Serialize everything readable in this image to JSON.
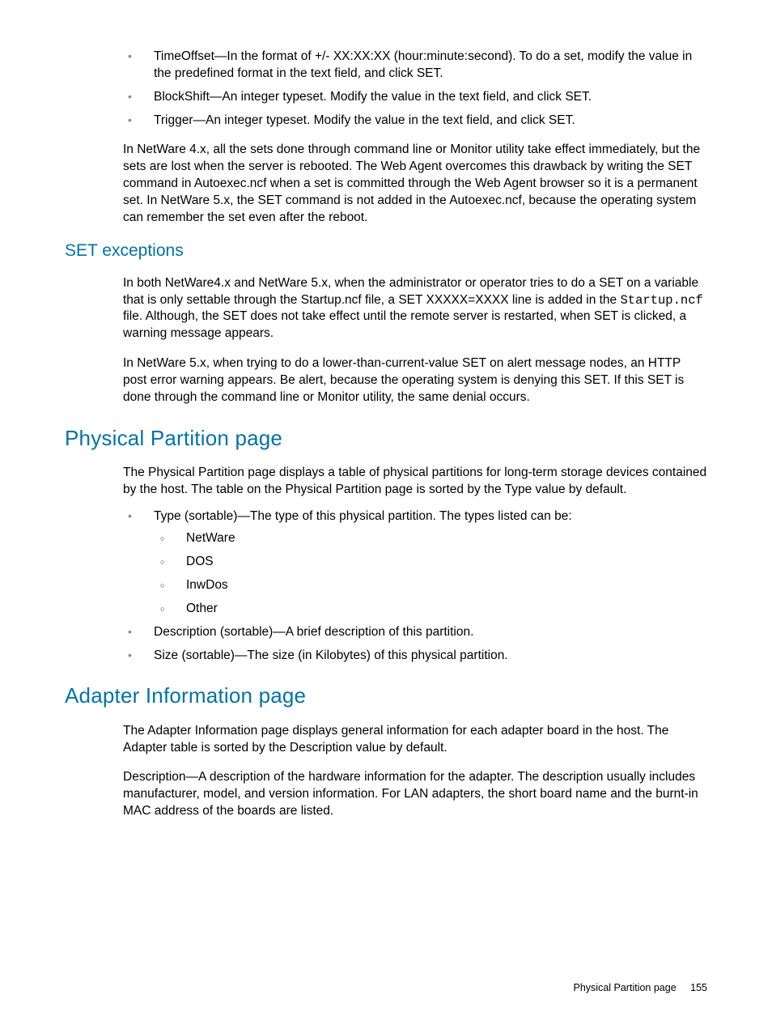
{
  "top_list": [
    "TimeOffset—In the format of +/- XX:XX:XX (hour:minute:second). To do a set, modify the value in the predefined format in the text field, and click SET.",
    "BlockShift—An integer typeset. Modify the value in the text field, and click SET.",
    "Trigger—An integer typeset. Modify the value in the text field, and click SET."
  ],
  "para_netware4": "In NetWare 4.x, all the sets done through command line or Monitor utility take effect immediately, but the sets are lost when the server is rebooted. The Web Agent overcomes this drawback by writing the SET command in Autoexec.ncf when a set is committed through the Web Agent browser so it is a permanent set. In NetWare 5.x, the SET command is not added in the Autoexec.ncf, because the operating system can remember the set even after the reboot.",
  "set_exceptions": {
    "heading": "SET exceptions",
    "p1_prefix": "In both NetWare4.x and NetWare 5.x, when the administrator or operator tries to do a SET on a variable that is only settable through the Startup.ncf file, a SET XXXXX=XXXX line is added in the ",
    "p1_mono": "Startup.ncf",
    "p1_suffix": " file. Although, the SET does not take effect until the remote server is restarted, when SET is clicked, a warning message appears.",
    "p2": "In NetWare 5.x, when trying to do a lower-than-current-value SET on alert message nodes, an HTTP post error warning appears. Be alert, because the operating system is denying this SET. If this SET is done through the command line or Monitor utility, the same denial occurs."
  },
  "physical_partition": {
    "heading": "Physical Partition page",
    "intro": "The Physical Partition page displays a table of physical partitions for long-term storage devices contained by the host. The table on the Physical Partition page is sorted by the Type value by default.",
    "type_line": "Type (sortable)—The type of this physical partition. The types listed can be:",
    "type_sublist": [
      "NetWare",
      "DOS",
      "InwDos",
      "Other"
    ],
    "desc_line": "Description (sortable)—A brief description of this partition.",
    "size_line": "Size (sortable)—The size (in Kilobytes) of this physical partition."
  },
  "adapter_info": {
    "heading": "Adapter Information page",
    "p1": "The Adapter Information page displays general information for each adapter board in the host. The Adapter table is sorted by the Description value by default.",
    "p2": "Description—A description of the hardware information for the adapter. The description usually includes manufacturer, model, and version information. For LAN adapters, the short board name and the burnt-in MAC address of the boards are listed."
  },
  "footer": {
    "section": "Physical Partition page",
    "page": "155"
  }
}
